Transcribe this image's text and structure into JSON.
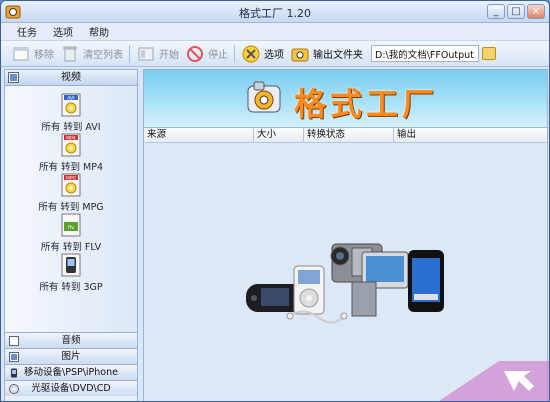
{
  "window": {
    "title": "格式工厂 1.20"
  },
  "menu": [
    "任务",
    "选项",
    "帮助"
  ],
  "toolbar": {
    "remove": "移除",
    "clear": "清空列表",
    "start": "开始",
    "stop": "停止",
    "options": "选项",
    "output_folder": "输出文件夹",
    "output_path": "D:\\我的文档\\FFOutput"
  },
  "left_panel": {
    "video_header": "视频",
    "formats": [
      {
        "label": "所有 转到 AVI",
        "badge": "AVI",
        "icon": "avi-icon"
      },
      {
        "label": "所有 转到 MP4",
        "badge": "MP4",
        "icon": "mp4-icon"
      },
      {
        "label": "所有 转到 MPG",
        "badge": "MPG",
        "icon": "mpg-icon"
      },
      {
        "label": "所有 转到 FLV",
        "badge": "flv",
        "icon": "flv-icon"
      },
      {
        "label": "所有 转到 3GP",
        "badge": "3GP",
        "icon": "3gp-icon"
      }
    ],
    "audio": "音频",
    "picture": "图片",
    "mobile": "移动设备\\PSP\\iPhone",
    "optical": "光驱设备\\DVD\\CD"
  },
  "banner": {
    "title": "格式工厂"
  },
  "table": {
    "columns": [
      "来源",
      "大小",
      "转换状态",
      "输出"
    ]
  },
  "colors": {
    "banner_text": "#ff8a1e",
    "accent_blue": "#79cdf0",
    "window_bg": "#d9e6f7"
  }
}
